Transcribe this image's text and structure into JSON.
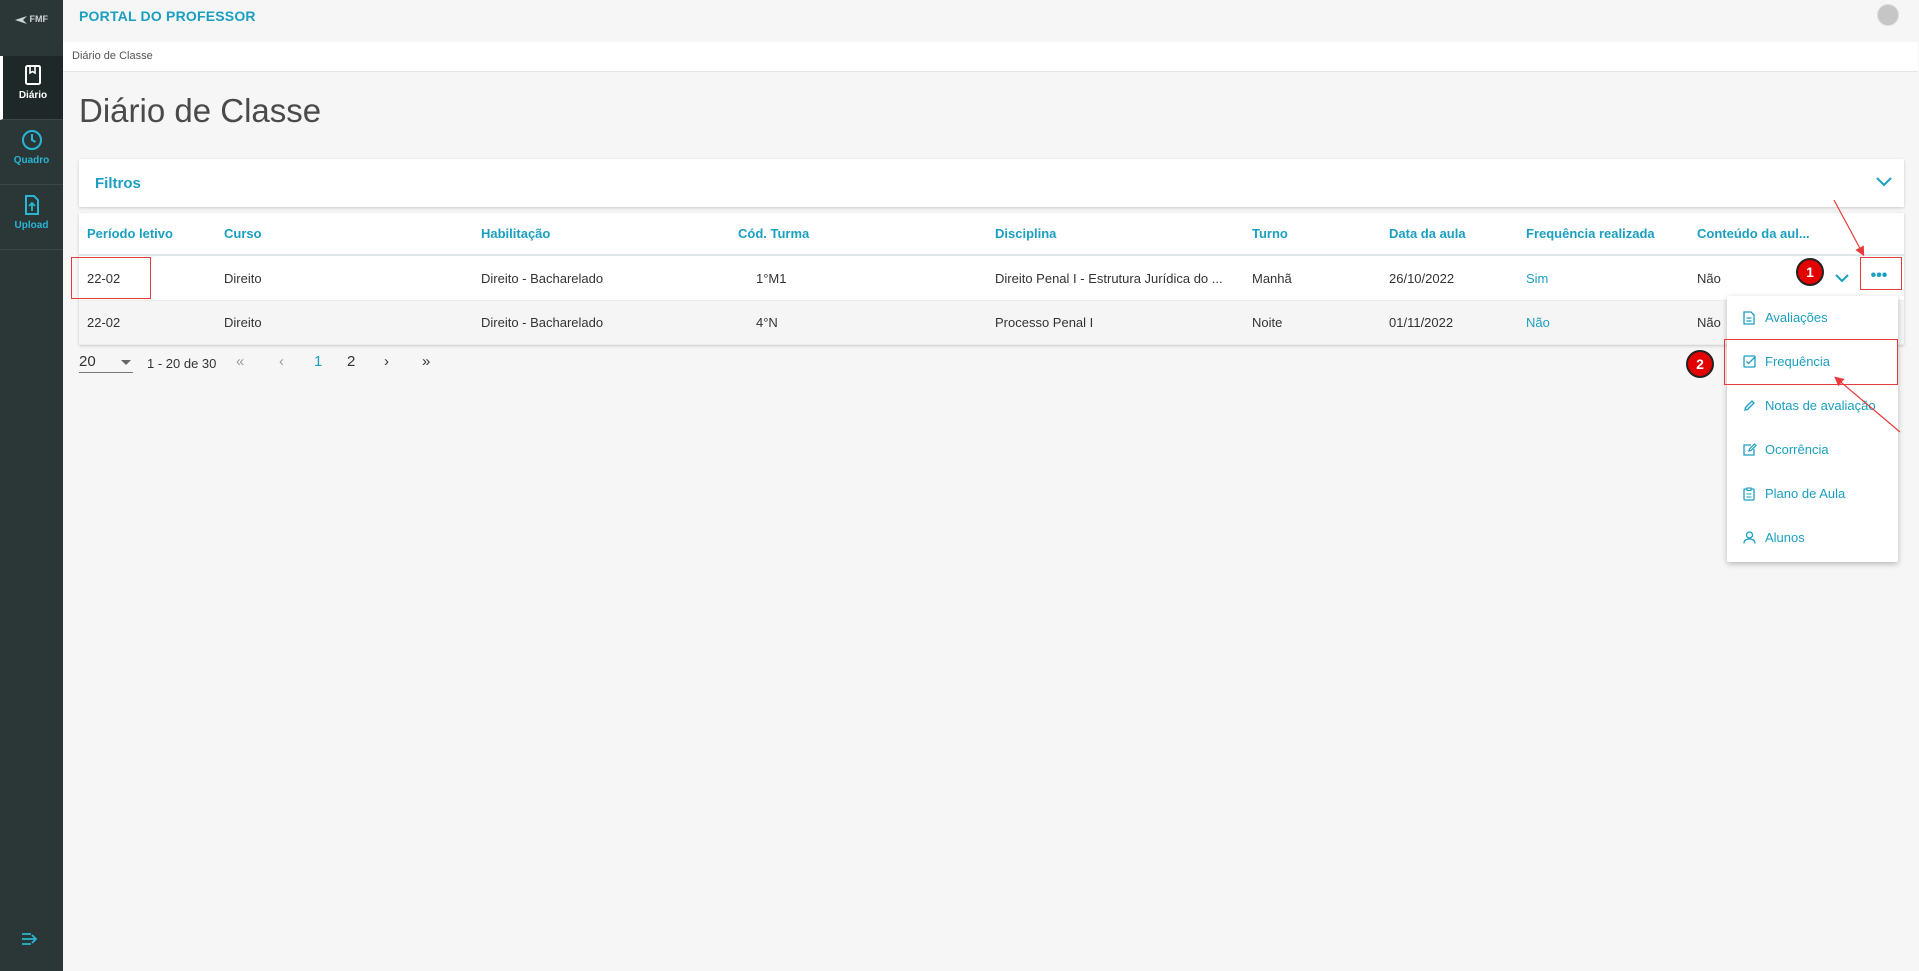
{
  "brand": {
    "logo_text": "FMF"
  },
  "app": {
    "title": "PORTAL DO PROFESSOR"
  },
  "nav": {
    "items": [
      {
        "label": "Diário",
        "icon": "book-icon"
      },
      {
        "label": "Quadro",
        "icon": "clock-icon"
      },
      {
        "label": "Upload",
        "icon": "file-upload-icon"
      }
    ],
    "collapse_icon": "expand-sidebar-icon"
  },
  "breadcrumb": {
    "current": "Diário de Classe"
  },
  "page": {
    "title": "Diário de Classe"
  },
  "filters": {
    "label": "Filtros"
  },
  "table": {
    "headers": [
      "Período letivo",
      "Curso",
      "Habilitação",
      "Cód. Turma",
      "Disciplina",
      "Turno",
      "Data da aula",
      "Frequência realizada",
      "Conteúdo da aul..."
    ],
    "rows": [
      [
        "22-02",
        "Direito",
        "Direito - Bacharelado",
        "1°M1",
        "Direito Penal I - Estrutura Jurídica do ...",
        "Manhã",
        "26/10/2022",
        "Sim",
        "Não"
      ],
      [
        "22-02",
        "Direito",
        "Direito - Bacharelado",
        "4°N",
        "Processo Penal I",
        "Noite",
        "01/11/2022",
        "Não",
        "Não"
      ]
    ]
  },
  "pagination": {
    "page_size": "20",
    "range": "1 - 20 de 30",
    "first": "«",
    "prev": "‹",
    "pages": [
      "1",
      "2"
    ],
    "current_page": "1",
    "next": "›",
    "last": "»"
  },
  "actions_menu": {
    "trigger": "•••",
    "items": [
      {
        "label": "Avaliações",
        "icon": "document-icon"
      },
      {
        "label": "Frequência",
        "icon": "checkbox-icon"
      },
      {
        "label": "Notas de avaliação",
        "icon": "pencil-icon"
      },
      {
        "label": "Ocorrência",
        "icon": "edit-note-icon"
      },
      {
        "label": "Plano de Aula",
        "icon": "clipboard-icon"
      },
      {
        "label": "Alunos",
        "icon": "user-icon"
      }
    ]
  },
  "annotations": {
    "step1": "1",
    "step2": "2"
  },
  "colors": {
    "accent": "#1a9fc0",
    "sidebar": "#2b3637",
    "annotation": "#e30000"
  }
}
